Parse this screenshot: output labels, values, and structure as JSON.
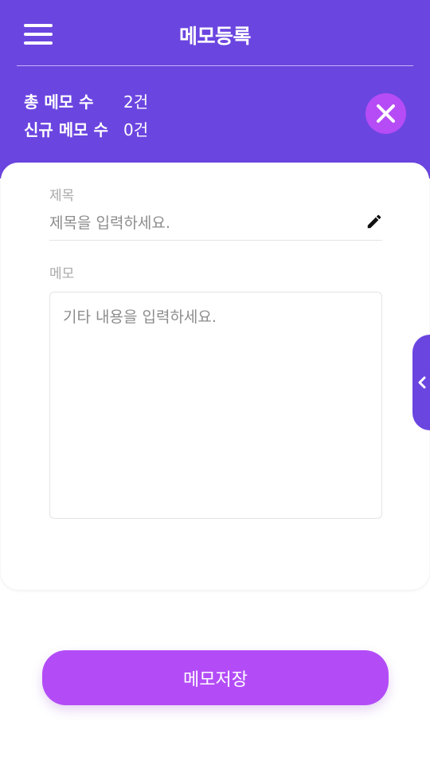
{
  "header": {
    "title": "메모등록",
    "menu_icon": "hamburger-menu-icon",
    "close_icon": "close-x-icon"
  },
  "stats": {
    "total_label": "총 메모 수",
    "total_value": "2건",
    "new_label": "신규 메모 수",
    "new_value": "0건"
  },
  "form": {
    "title_label": "제목",
    "title_placeholder": "제목을 입력하세요.",
    "title_value": "",
    "title_icon": "pencil-icon",
    "memo_label": "메모",
    "memo_placeholder": "기타 내용을 입력하세요.",
    "memo_value": ""
  },
  "side_tab": {
    "icon": "chevron-left-icon"
  },
  "actions": {
    "save_label": "메모저장"
  },
  "colors": {
    "header_bg": "#6b45e0",
    "accent": "#b34cf7",
    "close_button_bg": "#b64cf5",
    "label_gray": "#a9a9a9"
  }
}
